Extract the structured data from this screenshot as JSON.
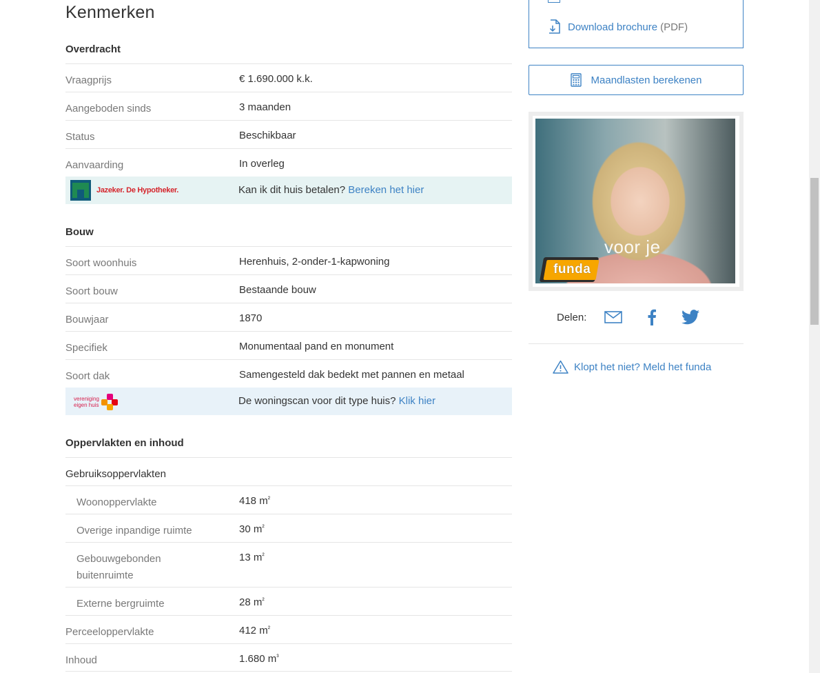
{
  "page_title": "Kenmerken",
  "sections": {
    "overdracht": {
      "title": "Overdracht",
      "rows": [
        {
          "label": "Vraagprijs",
          "value": "€ 1.690.000 k.k."
        },
        {
          "label": "Aangeboden sinds",
          "value": "3 maanden"
        },
        {
          "label": "Status",
          "value": "Beschikbaar"
        },
        {
          "label": "Aanvaarding",
          "value": "In overleg"
        }
      ],
      "promo": {
        "logo_text": "Jazeker. De Hypotheker.",
        "text": "Kan ik dit huis betalen?",
        "link": "Bereken het hier"
      }
    },
    "bouw": {
      "title": "Bouw",
      "rows": [
        {
          "label": "Soort woonhuis",
          "value": "Herenhuis, 2-onder-1-kapwoning"
        },
        {
          "label": "Soort bouw",
          "value": "Bestaande bouw"
        },
        {
          "label": "Bouwjaar",
          "value": "1870"
        },
        {
          "label": "Specifiek",
          "value": "Monumentaal pand en monument"
        },
        {
          "label": "Soort dak",
          "value": "Samengesteld dak bedekt met pannen en metaal"
        }
      ],
      "promo": {
        "logo_line1": "vereniging",
        "logo_line2": "eigen huis",
        "text": "De woningscan voor dit type huis?",
        "link": "Klik hier"
      }
    },
    "oppervlakten": {
      "title": "Oppervlakten en inhoud",
      "group_label": "Gebruiksoppervlakten",
      "sub_rows": [
        {
          "label": "Woonoppervlakte",
          "value": "418 m",
          "unit_exp": "²"
        },
        {
          "label": "Overige inpandige ruimte",
          "value": "30 m",
          "unit_exp": "²"
        },
        {
          "label_line1": "Gebouwgebonden",
          "label_line2": "buitenruimte",
          "value": "13 m",
          "unit_exp": "²"
        },
        {
          "label": "Externe bergruimte",
          "value": "28 m",
          "unit_exp": "²"
        }
      ],
      "rows": [
        {
          "label": "Perceeloppervlakte",
          "value": "412 m",
          "unit_exp": "²"
        },
        {
          "label": "Inhoud",
          "value": "1.680 m",
          "unit_exp": "³"
        }
      ]
    }
  },
  "sidebar": {
    "download": {
      "label": "Download brochure",
      "ext": "(PDF)"
    },
    "calc_button": "Maandlasten berekenen",
    "ad": {
      "tagline": "voor je",
      "brand": "funda"
    },
    "share_label": "Delen:",
    "report_label": "Klopt het niet? Meld het funda"
  },
  "colors": {
    "link": "#3d82c4",
    "muted": "#787878",
    "hypo_bg": "#e6f3f3",
    "veh_bg": "#e8f2f9",
    "funda_orange": "#f7a600"
  }
}
